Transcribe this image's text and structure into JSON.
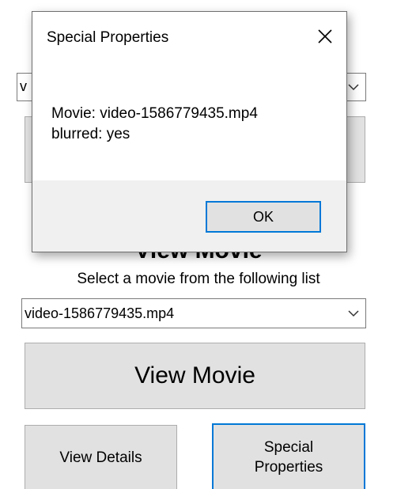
{
  "dialog": {
    "title": "Special Properties",
    "close_icon": "close-icon",
    "message_lines": [
      "Movie: video-1586779435.mp4",
      "blurred: yes"
    ],
    "ok_label": "OK"
  },
  "form": {
    "heading": "View Movie",
    "instruction": "Select a movie from the following list",
    "top_combo_value": "v",
    "movie_select": {
      "selected": "video-1586779435.mp4"
    },
    "view_movie_button": "View Movie",
    "view_details_button": "View Details",
    "special_properties_button": "Special\nProperties"
  },
  "colors": {
    "accent_focus": "#0078d7",
    "button_face": "#e1e1e1",
    "dialog_footer": "#f0f0f0"
  }
}
